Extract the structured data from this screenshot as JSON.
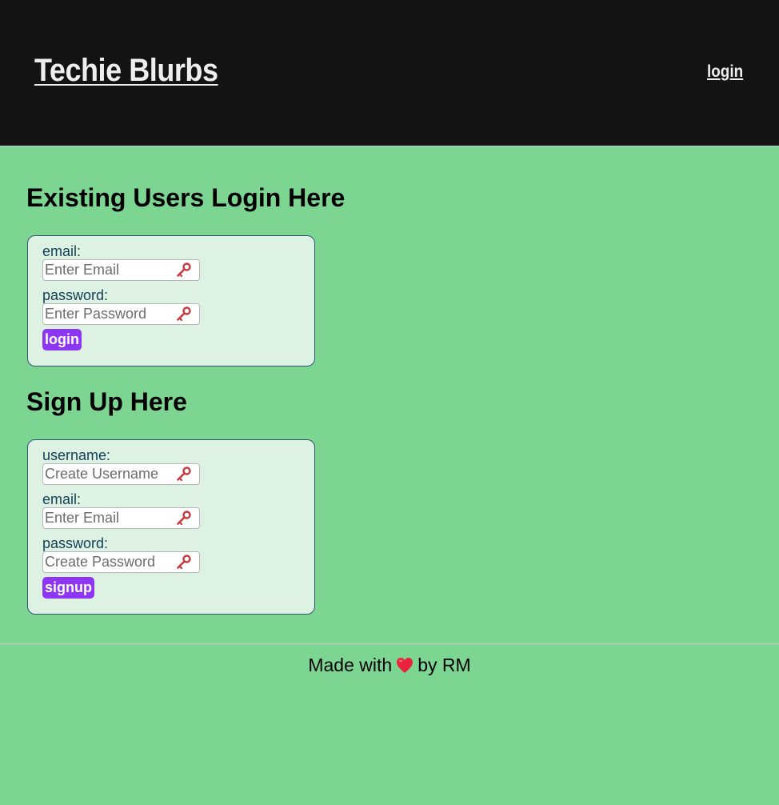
{
  "header": {
    "site_title": "Techie Blurbs",
    "nav_login": "login"
  },
  "login_section": {
    "heading": "Existing Users Login Here",
    "email_label": "email:",
    "email_placeholder": "Enter Email",
    "password_label": "password:",
    "password_placeholder": "Enter Password",
    "button_label": "login"
  },
  "signup_section": {
    "heading": "Sign Up Here",
    "username_label": "username:",
    "username_placeholder": "Create Username",
    "email_label": "email:",
    "email_placeholder": "Enter Email",
    "password_label": "password:",
    "password_placeholder": "Create Password",
    "button_label": "signup"
  },
  "footer": {
    "prefix": "Made with",
    "suffix": "by RM",
    "icon": "heart-icon"
  },
  "colors": {
    "page_bg": "#7dd592",
    "header_bg": "#131313",
    "card_bg": "#ddf2e2",
    "card_border": "#2b5773",
    "button_bg": "#8d37f5",
    "key_icon": "#c8393f"
  }
}
